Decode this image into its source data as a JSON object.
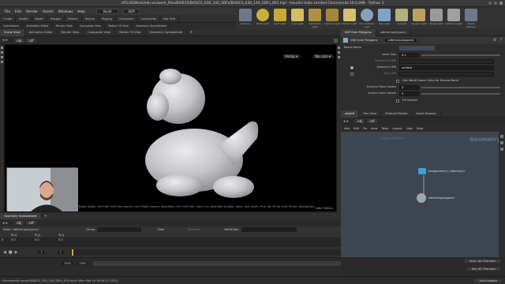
{
  "window": {
    "title": "/ATLAS/Work/edu-vis/work_files/BASICS/BASICS_030_140_SDFs/BASICS_030_140_SDFs_001.hipl - Houdini Indie Limited-Commercial 19.0.498 - Python 3"
  },
  "menu": {
    "items": [
      "File",
      "Edit",
      "Render",
      "Assets",
      "Windows",
      "Help"
    ],
    "build_label": "Build",
    "sop_label": "SOP"
  },
  "shelf_tabs": [
    "Create",
    "Modify",
    "Model",
    "Polygon",
    "Deform",
    "Texture",
    "Rigging",
    "Characters",
    "Constraints",
    "Hair Utils",
    "Guide Process",
    "Terrain FX",
    "Simple FX",
    "Volume"
  ],
  "shelf_tabs_row2": [
    "Subnetwork",
    "Animation Editor",
    "Render View",
    "Composite View",
    "Motion FX View",
    "Geometry Spreadsheet"
  ],
  "shelf_icons": [
    {
      "label": "Camera",
      "color": "#6a7a8a"
    },
    {
      "label": "Point Light",
      "color": "#c9b03a"
    },
    {
      "label": "Spot Light",
      "color": "#c9a83a"
    },
    {
      "label": "Area Light",
      "color": "#d0c060"
    },
    {
      "label": "Geometry Light",
      "color": "#b09040"
    },
    {
      "label": "Volume Light",
      "color": "#a08838"
    },
    {
      "label": "Distant Light",
      "color": "#d8c070"
    },
    {
      "label": "Environment Light",
      "color": "#8aa0b8"
    },
    {
      "label": "Sky Light",
      "color": "#7ea4c8"
    },
    {
      "label": "GI Light",
      "color": "#b0b080"
    },
    {
      "label": "Caustic Light",
      "color": "#c0a060"
    },
    {
      "label": "Portal Light",
      "color": "#9a9a9a"
    },
    {
      "label": "Ambient Light",
      "color": "#a0a0a0"
    },
    {
      "label": "Stereo Camera",
      "color": "#6a7a8a"
    }
  ],
  "viewport": {
    "tabs": [
      "Scene View",
      "Animation Editor",
      "Render View",
      "Composite View",
      "Motion FX View",
      "Geometry Spreadsheet"
    ],
    "path_obj": "obj",
    "path_node": "sdf",
    "persp_label": "Persp ▾",
    "cam_label": "No cam ▾",
    "hint_text": "Right slides; Ctrl+Alt+Left box zooms; Ctrl+Right zooms; Spacebar Ctrl+Left tilts. Hold [ for alternate tumble, dolly, and zoom.     M or Alt+M for First Person Navigation.",
    "edition_badge": "Indie Edition"
  },
  "spreadsheet": {
    "tab": "Geometry Spreadsheet",
    "path_obj": "obj",
    "path_node": "sdf",
    "node_label": "Node: vdbfrompolygons1",
    "group_label": "Group:",
    "view_label": "View",
    "intrinsics_label": "Intrinsics",
    "attributes_label": "Attributes:",
    "columns": [
      "",
      "P[x]",
      "P[y]",
      "P[z]"
    ],
    "rows": [
      [
        "0",
        "0.0",
        "0.0",
        "0.0"
      ]
    ]
  },
  "timeline": {
    "frame_start": "1",
    "frame_current": "1",
    "range_start": "1001",
    "range_current": "1001",
    "range_end": "1240",
    "range_end2": "1240",
    "ticks": [
      "24",
      "48",
      "72",
      "96",
      "120",
      "144",
      "168",
      "192",
      "216",
      "240"
    ]
  },
  "statusbar": {
    "message": "Successfully saved BASICS_030_140_SDFs_001.hiplc (Mon Feb 14 16:26:21 2022)",
    "auto_update": "Auto Update"
  },
  "params": {
    "tabs": [
      "SDF from Polygons",
      "vdbfrompolygons1"
    ],
    "node_type": "VDB from Polygons",
    "node_name": "vdbfrompolygons1",
    "section_label": "Reset Name",
    "rows": [
      {
        "label": "Voxel Size",
        "value": "0.1"
      },
      {
        "label": "Reference VDB",
        "value": ""
      },
      {
        "label": "Distance VDB",
        "value": "surface",
        "checked": true
      },
      {
        "label": "Fog VDB",
        "value": ""
      },
      {
        "label": "Use World Space Units for Narrow Band",
        "value": ""
      },
      {
        "label": "Exterior Band Voxels",
        "value": "3"
      },
      {
        "label": "Interior Band Voxels",
        "value": "3"
      },
      {
        "label": "Fill Interior",
        "value": ""
      }
    ]
  },
  "network": {
    "tabs": [
      "obj/sdf",
      "Tree View",
      "Material Palette",
      "Asset Browser"
    ],
    "path_obj": "obj",
    "path_node": "sdf",
    "menu_items": [
      "Add",
      "Edit",
      "Go",
      "View",
      "Tools",
      "Layout",
      "Labs",
      "Help"
    ],
    "watermark": "Indie Edition",
    "context_label": "Geometry",
    "nodes": [
      {
        "name": "testgeometry_rubbertoy1",
        "color": "#3fa0d8"
      },
      {
        "name": "vdbfrompolygons1",
        "color": "#8aa8d8"
      }
    ],
    "footer_buttons": [
      "Keys, All Channels",
      "Key All Channels"
    ]
  },
  "colors": {
    "accent_orange": "#e8a030",
    "selection_blue": "#3c6e9e",
    "viewport_bg": "#000000",
    "network_bg": "#3d4650"
  }
}
